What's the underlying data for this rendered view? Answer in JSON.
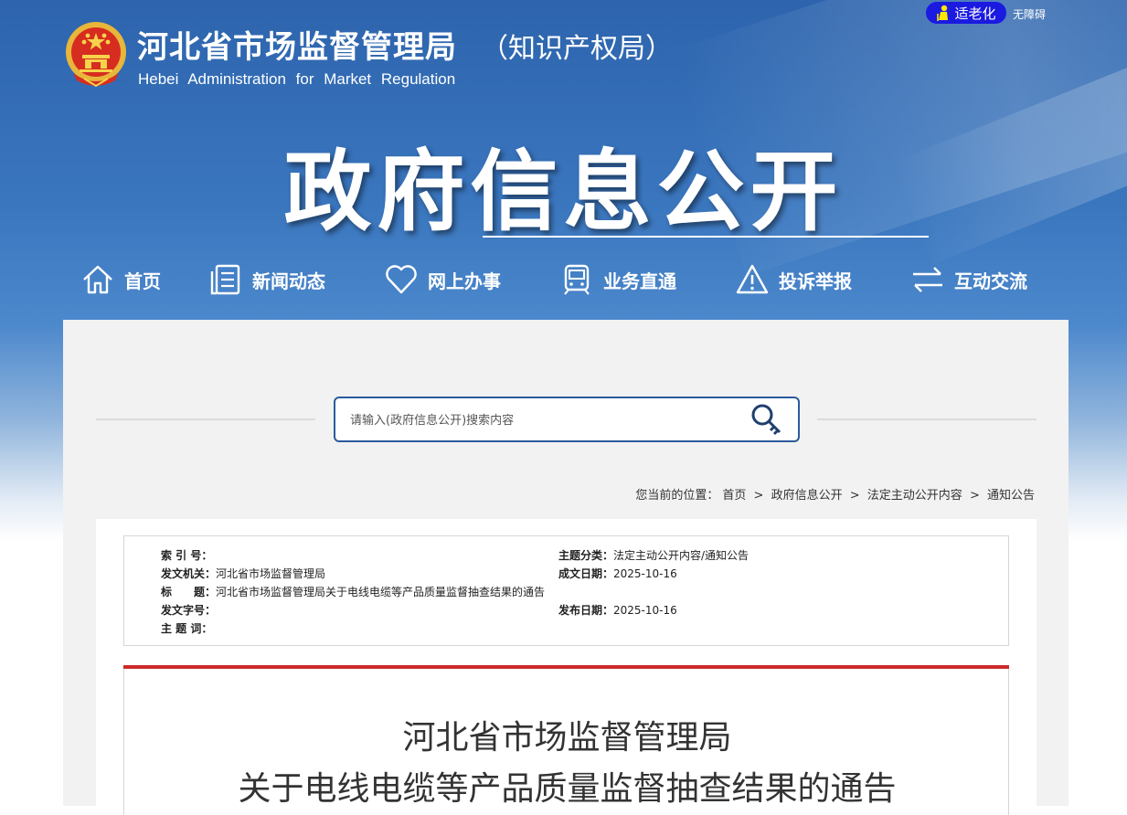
{
  "header": {
    "site_title": "河北省市场监督管理局",
    "site_subtitle": "（知识产权局）",
    "site_english": "Hebei Administration for Market Regulation",
    "elder_mode_label": "适老化",
    "accessibility_label": "无障碍",
    "section_title": "政府信息公开"
  },
  "nav": {
    "items": [
      {
        "label": "首页",
        "icon": "home-icon"
      },
      {
        "label": "新闻动态",
        "icon": "news-document-icon"
      },
      {
        "label": "网上办事",
        "icon": "heart-icon"
      },
      {
        "label": "业务直通",
        "icon": "train-icon"
      },
      {
        "label": "投诉举报",
        "icon": "warning-icon"
      },
      {
        "label": "互动交流",
        "icon": "exchange-arrows-icon"
      }
    ]
  },
  "search": {
    "placeholder": "请输入(政府信息公开)搜索内容",
    "icon": "search-key-icon"
  },
  "breadcrumb": {
    "prefix": "您当前的位置：",
    "items": [
      "首页",
      "政府信息公开",
      "法定主动公开内容",
      "通知公告"
    ],
    "separator": ">"
  },
  "meta": {
    "index_no": {
      "label": "索 引 号：",
      "value": ""
    },
    "topic": {
      "label": "主题分类：",
      "value": "法定主动公开内容/通知公告"
    },
    "issuer": {
      "label": "发文机关：",
      "value": "河北省市场监督管理局"
    },
    "created_date": {
      "label": "成文日期：",
      "value": "2025-10-16"
    },
    "title": {
      "label": "标　　题：",
      "value": "河北省市场监督管理局关于电线电缆等产品质量监督抽查结果的通告"
    },
    "doc_no": {
      "label": "发文字号：",
      "value": ""
    },
    "published_date": {
      "label": "发布日期：",
      "value": "2025-10-16"
    },
    "keywords": {
      "label": "主 题 词：",
      "value": ""
    }
  },
  "article": {
    "title_line1": "河北省市场监督管理局",
    "title_line2": "关于电线电缆等产品质量监督抽查结果的通告"
  },
  "colors": {
    "accent_blue": "#2b5b9c",
    "elder_button": "#1a1ae0",
    "divider_red": "#cc2a2a"
  }
}
